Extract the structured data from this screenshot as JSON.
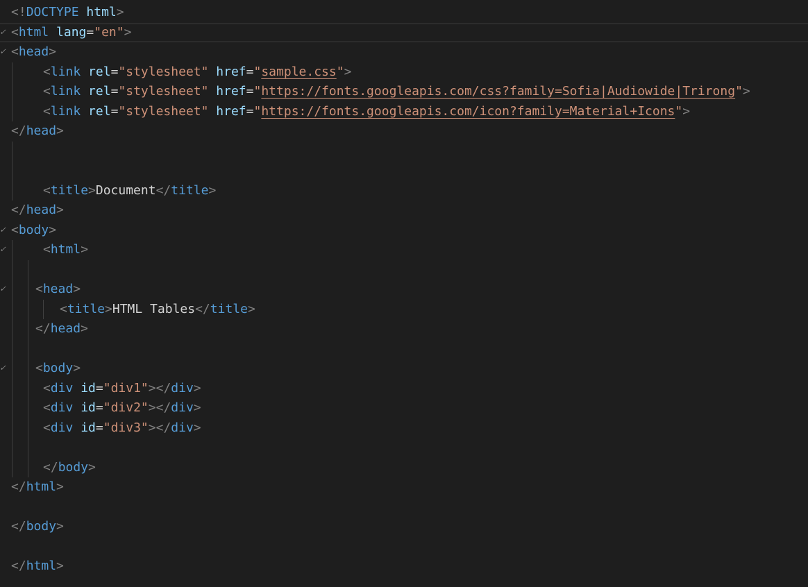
{
  "colors": {
    "background": "#1e1e1e",
    "punctuation": "#808080",
    "tag": "#569cd6",
    "attribute": "#9cdcfe",
    "string": "#ce9178",
    "text": "#d4d4d4"
  },
  "lines": [
    {
      "fold": "",
      "tokens": [
        [
          "punc",
          "<!"
        ],
        [
          "tag",
          "DOCTYPE"
        ],
        [
          "text",
          " "
        ],
        [
          "attr",
          "html"
        ],
        [
          "punc",
          ">"
        ]
      ]
    },
    {
      "fold": "✓",
      "current": true,
      "tokens": [
        [
          "punc",
          "<"
        ],
        [
          "tag",
          "html"
        ],
        [
          "text",
          " "
        ],
        [
          "attr",
          "lang"
        ],
        [
          "text",
          "="
        ],
        [
          "str",
          "\"en\""
        ],
        [
          "punc",
          ">"
        ]
      ]
    },
    {
      "fold": "✓",
      "tokens": [
        [
          "punc",
          "<"
        ],
        [
          "tag",
          "head"
        ],
        [
          "punc",
          ">"
        ]
      ]
    },
    {
      "fold": "",
      "tokens": [
        [
          "punc",
          "<"
        ],
        [
          "tag",
          "link"
        ],
        [
          "text",
          " "
        ],
        [
          "attr",
          "rel"
        ],
        [
          "text",
          "="
        ],
        [
          "str",
          "\"stylesheet\""
        ],
        [
          "text",
          " "
        ],
        [
          "attr",
          "href"
        ],
        [
          "text",
          "="
        ],
        [
          "str",
          "\""
        ],
        [
          "link",
          "sample.css"
        ],
        [
          "str",
          "\""
        ],
        [
          "punc",
          ">"
        ]
      ]
    },
    {
      "fold": "",
      "tokens": [
        [
          "punc",
          "<"
        ],
        [
          "tag",
          "link"
        ],
        [
          "text",
          " "
        ],
        [
          "attr",
          "rel"
        ],
        [
          "text",
          "="
        ],
        [
          "str",
          "\"stylesheet\""
        ],
        [
          "text",
          " "
        ],
        [
          "attr",
          "href"
        ],
        [
          "text",
          "="
        ],
        [
          "str",
          "\""
        ],
        [
          "link",
          "https://fonts.googleapis.com/css?family=Sofia|Audiowide|Trirong"
        ],
        [
          "str",
          "\""
        ],
        [
          "punc",
          ">"
        ]
      ]
    },
    {
      "fold": "",
      "tokens": [
        [
          "punc",
          "<"
        ],
        [
          "tag",
          "link"
        ],
        [
          "text",
          " "
        ],
        [
          "attr",
          "rel"
        ],
        [
          "text",
          "="
        ],
        [
          "str",
          "\"stylesheet\""
        ],
        [
          "text",
          " "
        ],
        [
          "attr",
          "href"
        ],
        [
          "text",
          "="
        ],
        [
          "str",
          "\""
        ],
        [
          "link",
          "https://fonts.googleapis.com/icon?family=Material+Icons"
        ],
        [
          "str",
          "\""
        ],
        [
          "punc",
          ">"
        ]
      ]
    },
    {
      "fold": "",
      "tokens": [
        [
          "punc",
          "</"
        ],
        [
          "tag",
          "head"
        ],
        [
          "punc",
          ">"
        ]
      ]
    },
    {
      "fold": "",
      "tokens": []
    },
    {
      "fold": "",
      "tokens": []
    },
    {
      "fold": "",
      "tokens": [
        [
          "punc",
          "<"
        ],
        [
          "tag",
          "title"
        ],
        [
          "punc",
          ">"
        ],
        [
          "text",
          "Document"
        ],
        [
          "punc",
          "</"
        ],
        [
          "tag",
          "title"
        ],
        [
          "punc",
          ">"
        ]
      ]
    },
    {
      "fold": "",
      "tokens": [
        [
          "punc",
          "</"
        ],
        [
          "tag",
          "head"
        ],
        [
          "punc",
          ">"
        ]
      ]
    },
    {
      "fold": "✓",
      "tokens": [
        [
          "punc",
          "<"
        ],
        [
          "tag",
          "body"
        ],
        [
          "punc",
          ">"
        ]
      ]
    },
    {
      "fold": "✓",
      "tokens": [
        [
          "punc",
          "<"
        ],
        [
          "tag",
          "html"
        ],
        [
          "punc",
          ">"
        ]
      ]
    },
    {
      "fold": "",
      "tokens": []
    },
    {
      "fold": "✓",
      "tokens": [
        [
          "punc",
          "<"
        ],
        [
          "tag",
          "head"
        ],
        [
          "punc",
          ">"
        ]
      ]
    },
    {
      "fold": "",
      "tokens": [
        [
          "punc",
          "<"
        ],
        [
          "tag",
          "title"
        ],
        [
          "punc",
          ">"
        ],
        [
          "text",
          "HTML Tables"
        ],
        [
          "punc",
          "</"
        ],
        [
          "tag",
          "title"
        ],
        [
          "punc",
          ">"
        ]
      ]
    },
    {
      "fold": "",
      "tokens": [
        [
          "punc",
          "</"
        ],
        [
          "tag",
          "head"
        ],
        [
          "punc",
          ">"
        ]
      ]
    },
    {
      "fold": "",
      "tokens": []
    },
    {
      "fold": "✓",
      "tokens": [
        [
          "punc",
          "<"
        ],
        [
          "tag",
          "body"
        ],
        [
          "punc",
          ">"
        ]
      ]
    },
    {
      "fold": "",
      "tokens": [
        [
          "punc",
          "<"
        ],
        [
          "tag",
          "div"
        ],
        [
          "text",
          " "
        ],
        [
          "attr",
          "id"
        ],
        [
          "text",
          "="
        ],
        [
          "str",
          "\"div1\""
        ],
        [
          "punc",
          "></"
        ],
        [
          "tag",
          "div"
        ],
        [
          "punc",
          ">"
        ]
      ]
    },
    {
      "fold": "",
      "tokens": [
        [
          "punc",
          "<"
        ],
        [
          "tag",
          "div"
        ],
        [
          "text",
          " "
        ],
        [
          "attr",
          "id"
        ],
        [
          "text",
          "="
        ],
        [
          "str",
          "\"div2\""
        ],
        [
          "punc",
          "></"
        ],
        [
          "tag",
          "div"
        ],
        [
          "punc",
          ">"
        ]
      ]
    },
    {
      "fold": "",
      "tokens": [
        [
          "punc",
          "<"
        ],
        [
          "tag",
          "div"
        ],
        [
          "text",
          " "
        ],
        [
          "attr",
          "id"
        ],
        [
          "text",
          "="
        ],
        [
          "str",
          "\"div3\""
        ],
        [
          "punc",
          "></"
        ],
        [
          "tag",
          "div"
        ],
        [
          "punc",
          ">"
        ]
      ]
    },
    {
      "fold": "",
      "tokens": []
    },
    {
      "fold": "",
      "tokens": [
        [
          "punc",
          "</"
        ],
        [
          "tag",
          "body"
        ],
        [
          "punc",
          ">"
        ]
      ]
    },
    {
      "fold": "",
      "tokens": [
        [
          "punc",
          "</"
        ],
        [
          "tag",
          "html"
        ],
        [
          "punc",
          ">"
        ]
      ]
    },
    {
      "fold": "",
      "tokens": []
    },
    {
      "fold": "",
      "tokens": [
        [
          "punc",
          "</"
        ],
        [
          "tag",
          "body"
        ],
        [
          "punc",
          ">"
        ]
      ]
    },
    {
      "fold": "",
      "tokens": []
    },
    {
      "fold": "",
      "tokens": [
        [
          "punc",
          "</"
        ],
        [
          "tag",
          "html"
        ],
        [
          "punc",
          ">"
        ]
      ]
    }
  ]
}
